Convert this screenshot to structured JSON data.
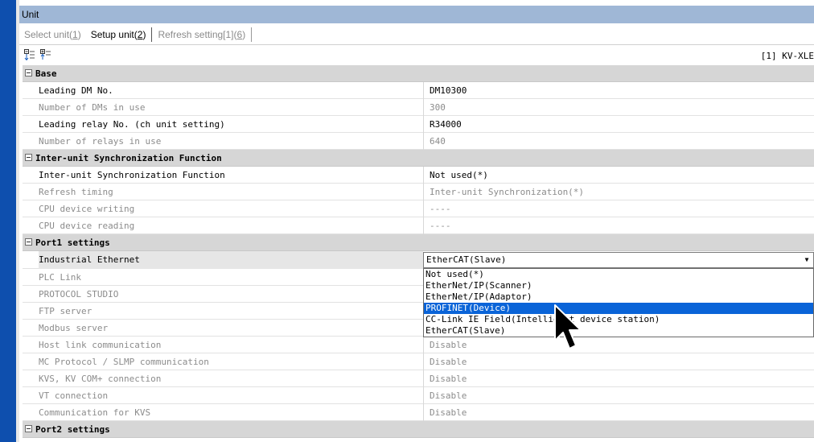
{
  "window": {
    "title": "Unit"
  },
  "tabs": [
    {
      "label": "Select unit(",
      "key": "1",
      "suffix": ")",
      "active": false
    },
    {
      "label": "Setup unit(",
      "key": "2",
      "suffix": ")",
      "active": true
    },
    {
      "label": "Refresh setting[1](",
      "key": "6",
      "suffix": ")",
      "active": false
    }
  ],
  "toolbar": {
    "icons": [
      "collapse-all-icon",
      "expand-all-icon"
    ],
    "unit_label": "[1]  KV-XLE"
  },
  "sections": {
    "base": "Base",
    "sync": "Inter-unit Synchronization Function",
    "port1": "Port1 settings",
    "port2": "Port2 settings"
  },
  "rows": {
    "leading_dm": {
      "name": "Leading DM No.",
      "value": "DM10300"
    },
    "num_dms": {
      "name": "Number of DMs in use",
      "value": "300"
    },
    "leading_relay": {
      "name": "Leading relay No. (ch unit setting)",
      "value": "R34000"
    },
    "num_relays": {
      "name": "Number of relays in use",
      "value": "640"
    },
    "sync_func": {
      "name": "Inter-unit Synchronization Function",
      "value": "Not used(*)"
    },
    "refresh_timing": {
      "name": "Refresh timing",
      "value": "Inter-unit Synchronization(*)"
    },
    "cpu_writing": {
      "name": "CPU device writing",
      "value": "----"
    },
    "cpu_reading": {
      "name": "CPU device reading",
      "value": "----"
    },
    "industrial_ethernet": {
      "name": "Industrial Ethernet",
      "value": "EtherCAT(Slave)"
    },
    "plc_link": {
      "name": "PLC Link",
      "value": ""
    },
    "protocol_studio": {
      "name": "PROTOCOL STUDIO",
      "value": ""
    },
    "ftp_server": {
      "name": "FTP server",
      "value": ""
    },
    "modbus_server": {
      "name": "Modbus server",
      "value": ""
    },
    "host_link": {
      "name": "Host link communication",
      "value": "Disable"
    },
    "mc_protocol": {
      "name": "MC Protocol / SLMP communication",
      "value": "Disable"
    },
    "kvs_connection": {
      "name": "KVS, KV COM+ connection",
      "value": "Disable"
    },
    "vt_connection": {
      "name": "VT connection",
      "value": "Disable"
    },
    "comm_kvs": {
      "name": "Communication for KVS",
      "value": "Disable"
    }
  },
  "dropdown": {
    "selected": "EtherCAT(Slave)",
    "highlighted": "PROFINET(Device)",
    "options": [
      "Not used(*)",
      "EtherNet/IP(Scanner)",
      "EtherNet/IP(Adaptor)",
      "PROFINET(Device)",
      "CC-Link IE Field(Intelligent device station)",
      "EtherCAT(Slave)"
    ]
  },
  "colors": {
    "title_bar": "#9fb7d6",
    "left_strip": "#0e4fae",
    "section_bg": "#d6d6d6",
    "highlight": "#0a64d8"
  }
}
